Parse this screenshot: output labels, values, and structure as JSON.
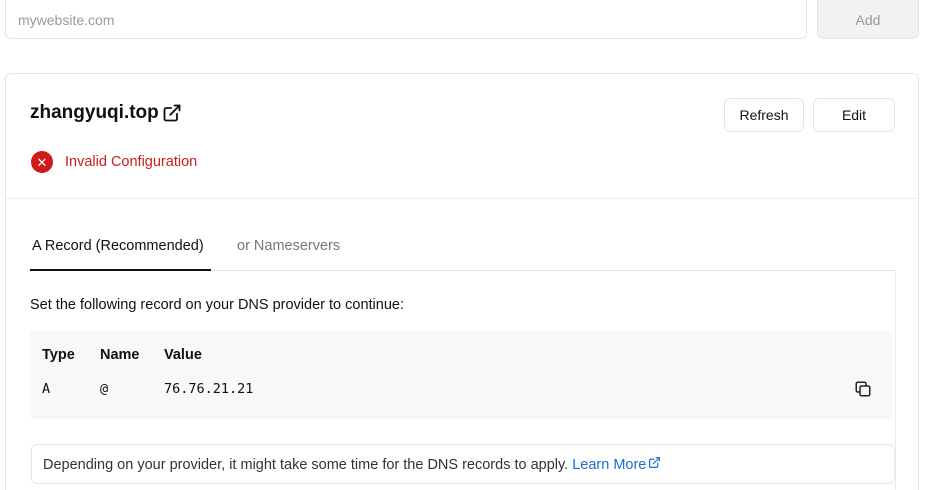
{
  "add_form": {
    "input_placeholder": "mywebsite.com",
    "add_label": "Add"
  },
  "domain": {
    "name": "zhangyuqi.top",
    "refresh_label": "Refresh",
    "edit_label": "Edit",
    "status_text": "Invalid Configuration",
    "status_color": "#d01b1b"
  },
  "tabs": [
    {
      "label": "A Record (Recommended)",
      "active": true
    },
    {
      "label": "or Nameservers",
      "active": false
    }
  ],
  "records_section": {
    "instruction": "Set the following record on your DNS provider to continue:",
    "headers": {
      "type": "Type",
      "name": "Name",
      "value": "Value"
    },
    "rows": [
      {
        "type": "A",
        "name": "@",
        "value": "76.76.21.21"
      }
    ],
    "copy_icon": "copy-icon"
  },
  "note": {
    "text": "Depending on your provider, it might take some time for the DNS records to apply.",
    "link_label": "Learn More"
  },
  "colors": {
    "error": "#c81e1e",
    "link": "#1a6fd6"
  }
}
